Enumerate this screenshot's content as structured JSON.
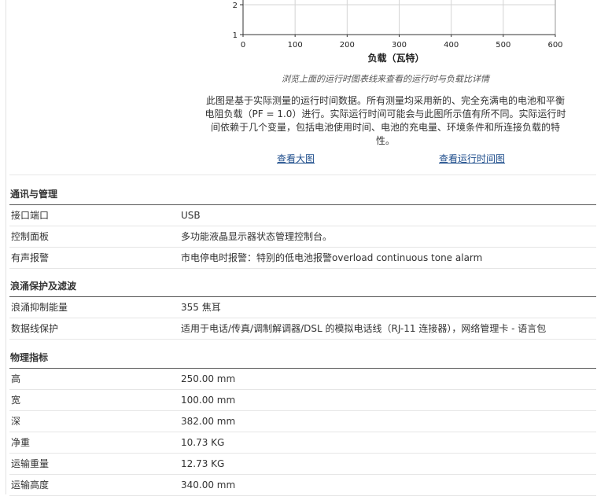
{
  "chart_data": {
    "type": "line",
    "xlabel": "负载（瓦特）",
    "x_ticks": [
      "0",
      "100",
      "200",
      "300",
      "400",
      "500",
      "600"
    ],
    "y_ticks_visible": [
      "2",
      "1"
    ],
    "xlim": [
      0,
      600
    ],
    "grid": true
  },
  "chart_caption": "浏览上面的运行时图表线来查看的运行时与负载比详情",
  "chart_desc": "此图是基于实际测量的运行时间数据。所有测量均采用新的、完全充满电的电池和平衡电阻负载（PF = 1.0）进行。实际运行时间可能会与此图所示值有所不同。实际运行时间依赖于几个变量，包括电池使用时间、电池的充电量、环境条件和所连接负载的特性。",
  "links": {
    "view_large": "查看大图",
    "view_runtime": "查看运行时间图"
  },
  "sections": [
    {
      "title": "通讯与管理",
      "rows": [
        {
          "k": "接口端口",
          "v": "USB"
        },
        {
          "k": "控制面板",
          "v": "多功能液晶显示器状态管理控制台。"
        },
        {
          "k": "有声报警",
          "v": "市电停电时报警：特别的低电池报警overload continuous tone alarm"
        }
      ]
    },
    {
      "title": "浪涌保护及滤波",
      "rows": [
        {
          "k": "浪涌抑制能量",
          "v": "355 焦耳"
        },
        {
          "k": "数据线保护",
          "v": "适用于电话/传真/调制解调器/DSL 的模拟电话线（RJ-11 连接器），网络管理卡 - 语言包"
        }
      ]
    },
    {
      "title": "物理指标",
      "rows": [
        {
          "k": "高",
          "v": "250.00 mm"
        },
        {
          "k": "宽",
          "v": "100.00 mm"
        },
        {
          "k": "深",
          "v": "382.00 mm"
        },
        {
          "k": "净重",
          "v": "10.73 KG"
        },
        {
          "k": "运输重量",
          "v": "12.73 KG"
        },
        {
          "k": "运输高度",
          "v": "340.00 mm"
        }
      ]
    }
  ]
}
